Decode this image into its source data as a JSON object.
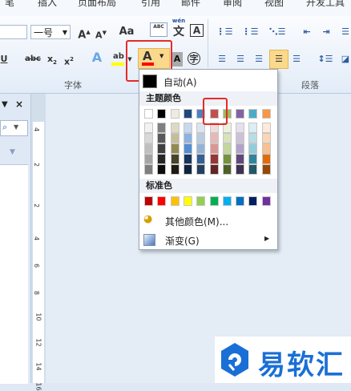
{
  "tabs": [
    "笔",
    "插入",
    "页面布局",
    "引用",
    "邮件",
    "审阅",
    "视图",
    "开发工具"
  ],
  "ribbon": {
    "font_size": "一号",
    "grow_font": "A",
    "shrink_font": "A",
    "change_case": "Aa",
    "clear_format": "ABC",
    "pinyin_top": "wén",
    "pinyin_char": "文",
    "char_border": "A",
    "underline": "U",
    "strikethrough": "abc",
    "subscript": "x",
    "superscript": "x",
    "text_effect": "A",
    "highlight": "ab",
    "font_color": "A",
    "char_shading": "A",
    "enclose_char": "字",
    "group_font": "字体",
    "group_paragraph": "段落"
  },
  "ruler_numbers": [
    "4",
    "2",
    "2",
    "4",
    "6",
    "8",
    "10",
    "12",
    "14",
    "16"
  ],
  "color_menu": {
    "automatic": "自动(A)",
    "theme_header": "主题颜色",
    "theme_top": [
      "#ffffff",
      "#000000",
      "#eeece1",
      "#1f497d",
      "#4f81bd",
      "#c0504d",
      "#9bbb59",
      "#8064a2",
      "#4bacc6",
      "#f79646"
    ],
    "theme_shades": [
      [
        "#f2f2f2",
        "#7f7f7f",
        "#ddd9c3",
        "#c6d9f0",
        "#dbe5f1",
        "#f2dcdb",
        "#ebf1dd",
        "#e5e0ec",
        "#dbeef3",
        "#fdeada"
      ],
      [
        "#d8d8d8",
        "#595959",
        "#c4bd97",
        "#8db3e2",
        "#b8cce4",
        "#e5b9b7",
        "#d7e3bc",
        "#ccc1d9",
        "#b7dde8",
        "#fbd5b5"
      ],
      [
        "#bfbfbf",
        "#3f3f3f",
        "#938953",
        "#548dd4",
        "#95b3d7",
        "#d99694",
        "#c3d69b",
        "#b2a2c7",
        "#92cddc",
        "#fac08f"
      ],
      [
        "#a5a5a5",
        "#262626",
        "#494429",
        "#17365d",
        "#366092",
        "#953734",
        "#76923c",
        "#5f497a",
        "#31859b",
        "#e36c09"
      ],
      [
        "#7f7f7f",
        "#0c0c0c",
        "#1d1b10",
        "#0f243e",
        "#244061",
        "#632423",
        "#4f6128",
        "#3f3151",
        "#205867",
        "#974806"
      ]
    ],
    "standard_header": "标准色",
    "standard": [
      "#c00000",
      "#ff0000",
      "#ffc000",
      "#ffff00",
      "#92d050",
      "#00b050",
      "#00b0f0",
      "#0070c0",
      "#002060",
      "#7030a0"
    ],
    "more_colors": "其他颜色(M)...",
    "gradient": "渐变(G)"
  },
  "logo": {
    "text": "易软汇",
    "color": "#1a6fd6"
  }
}
